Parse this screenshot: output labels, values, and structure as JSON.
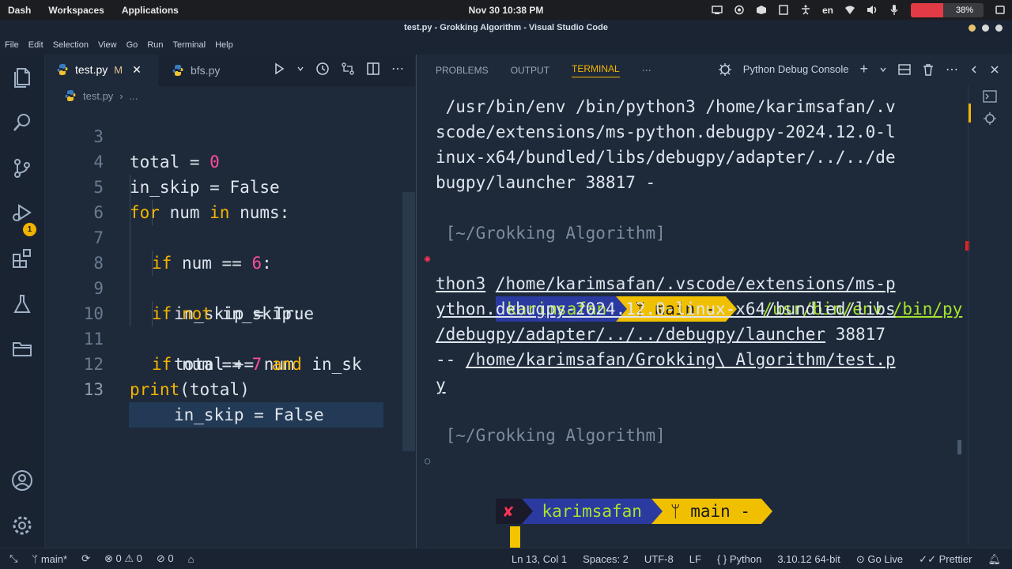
{
  "os": {
    "menus": [
      "Dash",
      "Workspaces",
      "Applications"
    ],
    "clock": "Nov 30  10:38 PM",
    "language": "en",
    "battery_percent": 38,
    "battery_label": "38%"
  },
  "window": {
    "title": "test.py - Grokking Algorithm - Visual Studio Code"
  },
  "menubar": [
    "File",
    "Edit",
    "Selection",
    "View",
    "Go",
    "Run",
    "Terminal",
    "Help"
  ],
  "activity_badge": "1",
  "tabs": [
    {
      "label": "test.py",
      "modified": "M"
    },
    {
      "label": "bfs.py"
    }
  ],
  "breadcrumb": {
    "file": "test.py",
    "more": "..."
  },
  "code_lines": [
    {
      "n": "3",
      "text": "total = 0"
    },
    {
      "n": "4",
      "text": "in_skip = False"
    },
    {
      "n": "5",
      "text": "for num in nums:"
    },
    {
      "n": "6",
      "text": "if num == 6:"
    },
    {
      "n": "7",
      "text": "in_skip = True"
    },
    {
      "n": "8",
      "text": "if not in_skip:"
    },
    {
      "n": "9",
      "text": "total += num"
    },
    {
      "n": "10",
      "text": "if num == 7 and in_sk"
    },
    {
      "n": "11",
      "text": "in_skip = False"
    },
    {
      "n": "12",
      "text": "print(total)"
    },
    {
      "n": "13",
      "text": ""
    }
  ],
  "panel": {
    "tabs": [
      "PROBLEMS",
      "OUTPUT",
      "TERMINAL"
    ],
    "active_tab": "TERMINAL",
    "debug_console": "Python Debug Console"
  },
  "terminal": {
    "l1": " /usr/bin/env /bin/python3 /home/karimsafan/.v",
    "l2": "scode/extensions/ms-python.debugpy-2024.12.0-l",
    "l3": "inux-x64/bundled/libs/debugpy/adapter/../../de",
    "l4": "bugpy/launcher 38817 -",
    "dir": " [~/Grokking Algorithm]",
    "user": "karimsafan",
    "branch": "main -",
    "cmd_a": "/usr/bin/env",
    "cmd_b": "/bin/py",
    "l7": "thon3",
    "l7b": "/home/karimsafan/.vscode/extensions/ms-p",
    "l8": "ython.debugpy-2024.12.0-linux-x64/bundled/libs",
    "l9": "/debugpy/adapter/../../debugpy/launcher",
    "l9b": "38817",
    "l10a": "--",
    "l10b": "/home/karimsafan/Grokking\\ Algorithm/test.p",
    "l11": "y",
    "x": "✘"
  },
  "status": {
    "branch": "main*",
    "errors": "0",
    "warnings": "0",
    "ports": "0",
    "position": "Ln 13, Col 1",
    "spaces": "Spaces: 2",
    "encoding": "UTF-8",
    "eol": "LF",
    "language": "Python",
    "interpreter": "3.10.12 64-bit",
    "golive": "Go Live",
    "prettier": "Prettier"
  }
}
